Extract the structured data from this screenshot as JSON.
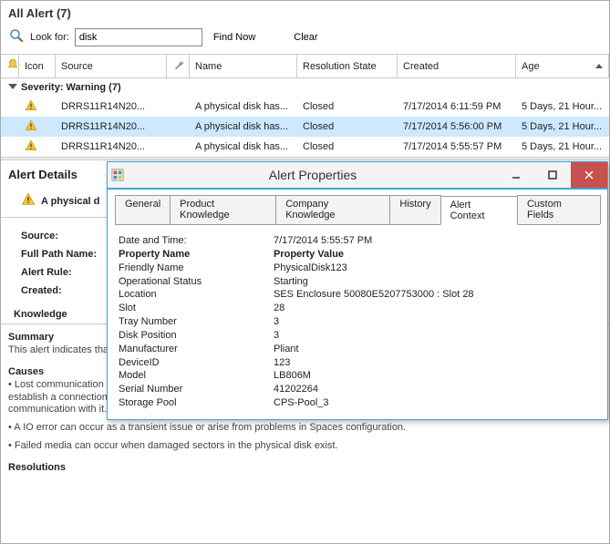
{
  "panel": {
    "title": "All Alert (7)"
  },
  "search": {
    "look_for_label": "Look for:",
    "value": "disk",
    "find_now": "Find Now",
    "clear": "Clear"
  },
  "columns": {
    "icon": "Icon",
    "source": "Source",
    "name": "Name",
    "resolution_state": "Resolution State",
    "created": "Created",
    "age": "Age"
  },
  "group": {
    "label": "Severity: Warning (7)"
  },
  "rows": [
    {
      "source": "DRRS11R14N20...",
      "name": "A physical disk has...",
      "res": "Closed",
      "created": "7/17/2014 6:11:59 PM",
      "age": "5 Days, 21 Hour..."
    },
    {
      "source": "DRRS11R14N20...",
      "name": "A physical disk has...",
      "res": "Closed",
      "created": "7/17/2014 5:56:00 PM",
      "age": "5 Days, 21 Hour..."
    },
    {
      "source": "DRRS11R14N20...",
      "name": "A physical disk has...",
      "res": "Closed",
      "created": "7/17/2014 5:55:57 PM",
      "age": "5 Days, 21 Hour..."
    }
  ],
  "details": {
    "panel_title": "Alert Details",
    "heading": "A physical d",
    "fields": {
      "source": "Source:",
      "full_path": "Full Path Name:",
      "alert_rule": "Alert Rule:",
      "created": "Created:"
    },
    "knowledge_label": "Knowledge",
    "summary_label": "Summary",
    "summary_text": "This alert indicates that a physical disk has suffered an IO error, the media has failed, or a connection to the physical disk cannot be...",
    "causes_label": "Causes",
    "cause1": "• Lost communication issues can occur because the storage provider once had communication with the disk, but can no longer establish a connection to it. Alternatively, the storage provider may have knowledge of the disk, but has never been able to establish communication with it.",
    "cause2": "• A IO error can occur as a transient issue or arise from problems in Spaces configuration.",
    "cause3": "• Failed media can occur when damaged sectors in the physical disk exist.",
    "resolutions_label": "Resolutions"
  },
  "dialog": {
    "title": "Alert Properties",
    "tabs": {
      "general": "General",
      "product": "Product Knowledge",
      "company": "Company Knowledge",
      "history": "History",
      "context": "Alert Context",
      "custom": "Custom Fields"
    },
    "kv_header": {
      "key": "Property Name",
      "val": "Property Value"
    },
    "kv": [
      {
        "key": "Date and Time:",
        "val": "7/17/2014 5:55:57 PM"
      },
      {
        "key": "Friendly Name",
        "val": "PhysicalDisk123"
      },
      {
        "key": "Operational Status",
        "val": "Starting"
      },
      {
        "key": "Location",
        "val": "SES Enclosure 50080E5207753000 : Slot 28"
      },
      {
        "key": "Slot",
        "val": "28"
      },
      {
        "key": "Tray Number",
        "val": "3"
      },
      {
        "key": "Disk Position",
        "val": "3"
      },
      {
        "key": "Manufacturer",
        "val": "Pliant"
      },
      {
        "key": "DeviceID",
        "val": "123"
      },
      {
        "key": "Model",
        "val": "LB806M"
      },
      {
        "key": "Serial Number",
        "val": "41202264"
      },
      {
        "key": "Storage Pool",
        "val": "CPS-Pool_3"
      }
    ]
  }
}
